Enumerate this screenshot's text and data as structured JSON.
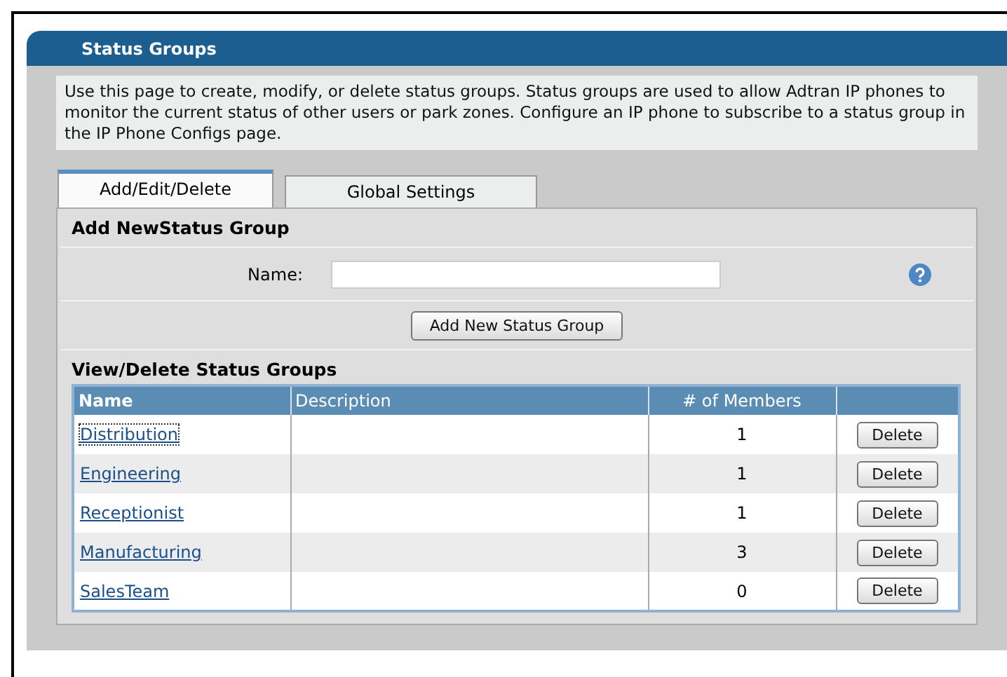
{
  "panel": {
    "title": "Status Groups"
  },
  "description": "Use this page to create, modify, or delete status groups. Status groups are used to allow Adtran IP phones to monitor the current status of other users or park zones. Configure an IP phone to subscribe to a status group in the IP Phone Configs page.",
  "tabs": [
    {
      "label": "Add/Edit/Delete",
      "selected": true
    },
    {
      "label": "Global Settings",
      "selected": false
    }
  ],
  "add_section": {
    "heading": "Add NewStatus Group",
    "name_label": "Name:",
    "add_button": "Add New Status Group"
  },
  "view_section": {
    "heading": "View/Delete Status Groups"
  },
  "table": {
    "columns": [
      "Name",
      "Description",
      "# of Members",
      ""
    ],
    "rows": [
      {
        "name": "Distribution",
        "members": "1",
        "action": "Delete",
        "focused": true
      },
      {
        "name": "Engineering",
        "members": "1",
        "action": "Delete",
        "focused": false
      },
      {
        "name": "Receptionist",
        "members": "1",
        "action": "Delete",
        "focused": false
      },
      {
        "name": "Manufacturing",
        "members": "3",
        "action": "Delete",
        "focused": false
      },
      {
        "name": "SalesTeam",
        "members": "0",
        "action": "Delete",
        "focused": false
      }
    ]
  }
}
